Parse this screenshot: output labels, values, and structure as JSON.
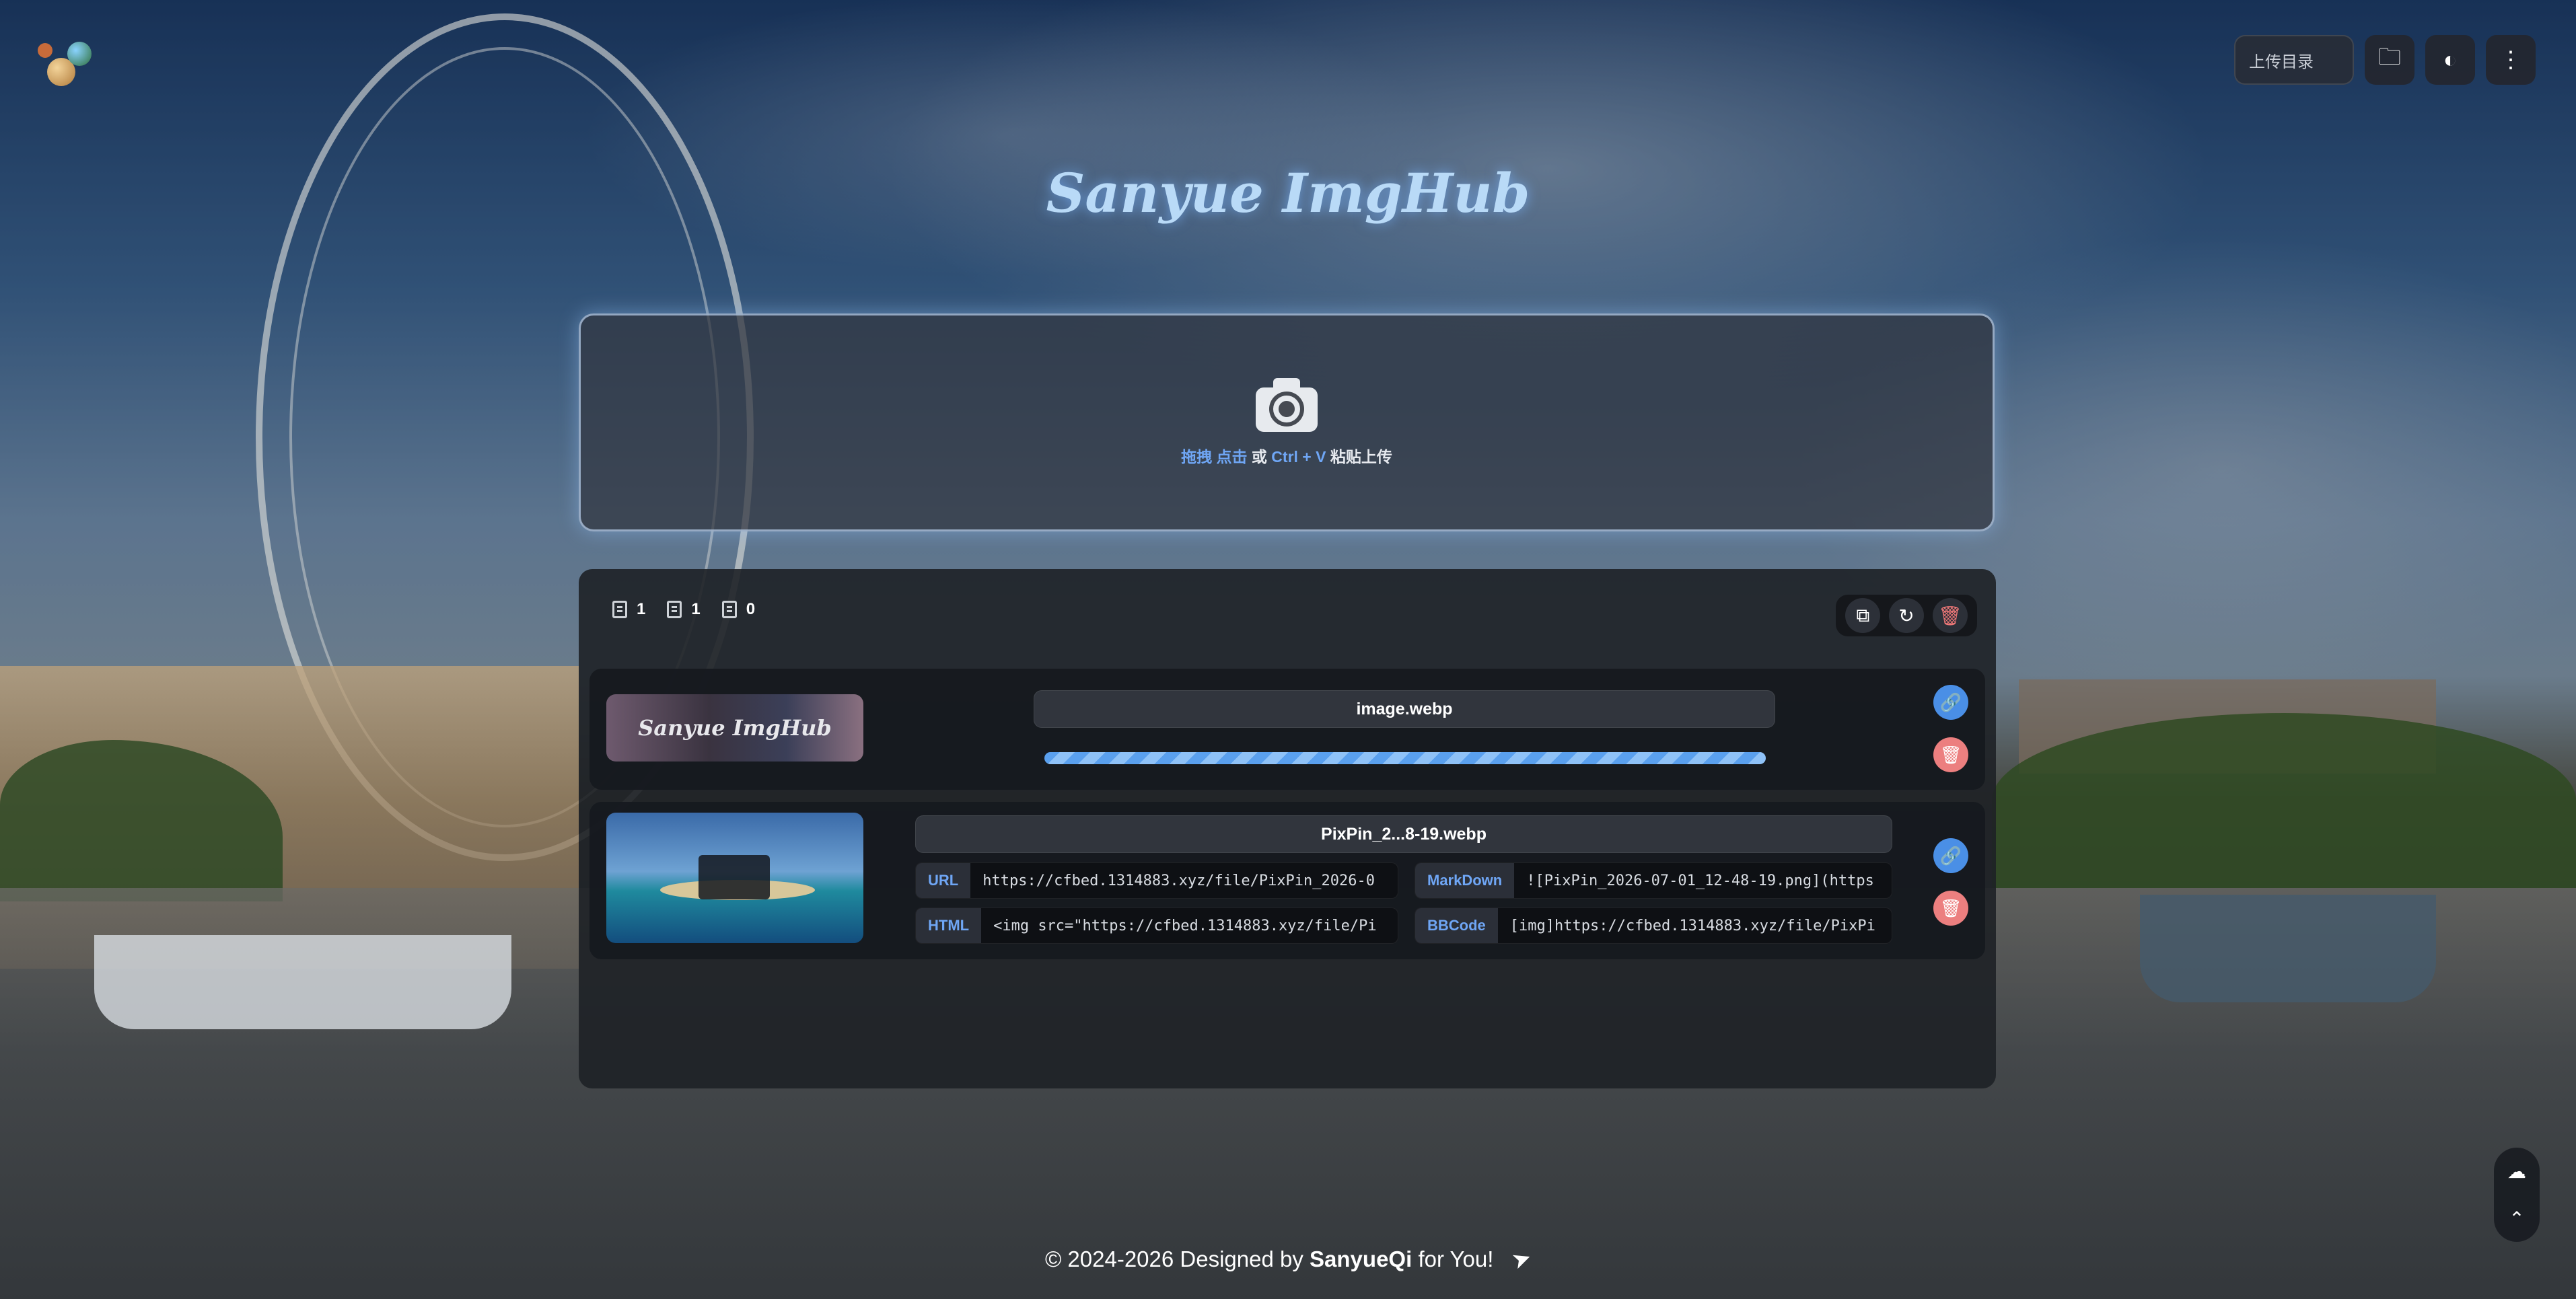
{
  "toolbar": {
    "upload_dir_placeholder": "上传目录"
  },
  "app": {
    "title": "Sanyue ImgHub"
  },
  "upload": {
    "text_drag": "拖拽",
    "text_click": "点击",
    "text_or": "或",
    "text_shortcut": "Ctrl + V",
    "text_paste": "粘贴上传"
  },
  "stats": {
    "total": "1",
    "success": "1",
    "failed": "0"
  },
  "files": [
    {
      "thumb_text": "Sanyue ImgHub",
      "name": "image.webp",
      "progress": 1.0
    },
    {
      "name": "PixPin_2...8-19.webp",
      "links": {
        "url_label": "URL",
        "url_value": "https://cfbed.1314883.xyz/file/PixPin_2026-0",
        "markdown_label": "MarkDown",
        "markdown_value": "![PixPin_2026-07-01_12-48-19.png](https",
        "html_label": "HTML",
        "html_value": "<img src=\"https://cfbed.1314883.xyz/file/Pi",
        "bbcode_label": "BBCode",
        "bbcode_value": "[img]https://cfbed.1314883.xyz/file/PixPi"
      }
    }
  ],
  "footer": {
    "prefix": "© 2024-2026 Designed by",
    "author": "SanyueQi",
    "suffix": "for You!"
  },
  "colors": {
    "accent": "#6fa6f5",
    "danger": "#ec7f7f",
    "title_glow": "#b9daf7"
  }
}
